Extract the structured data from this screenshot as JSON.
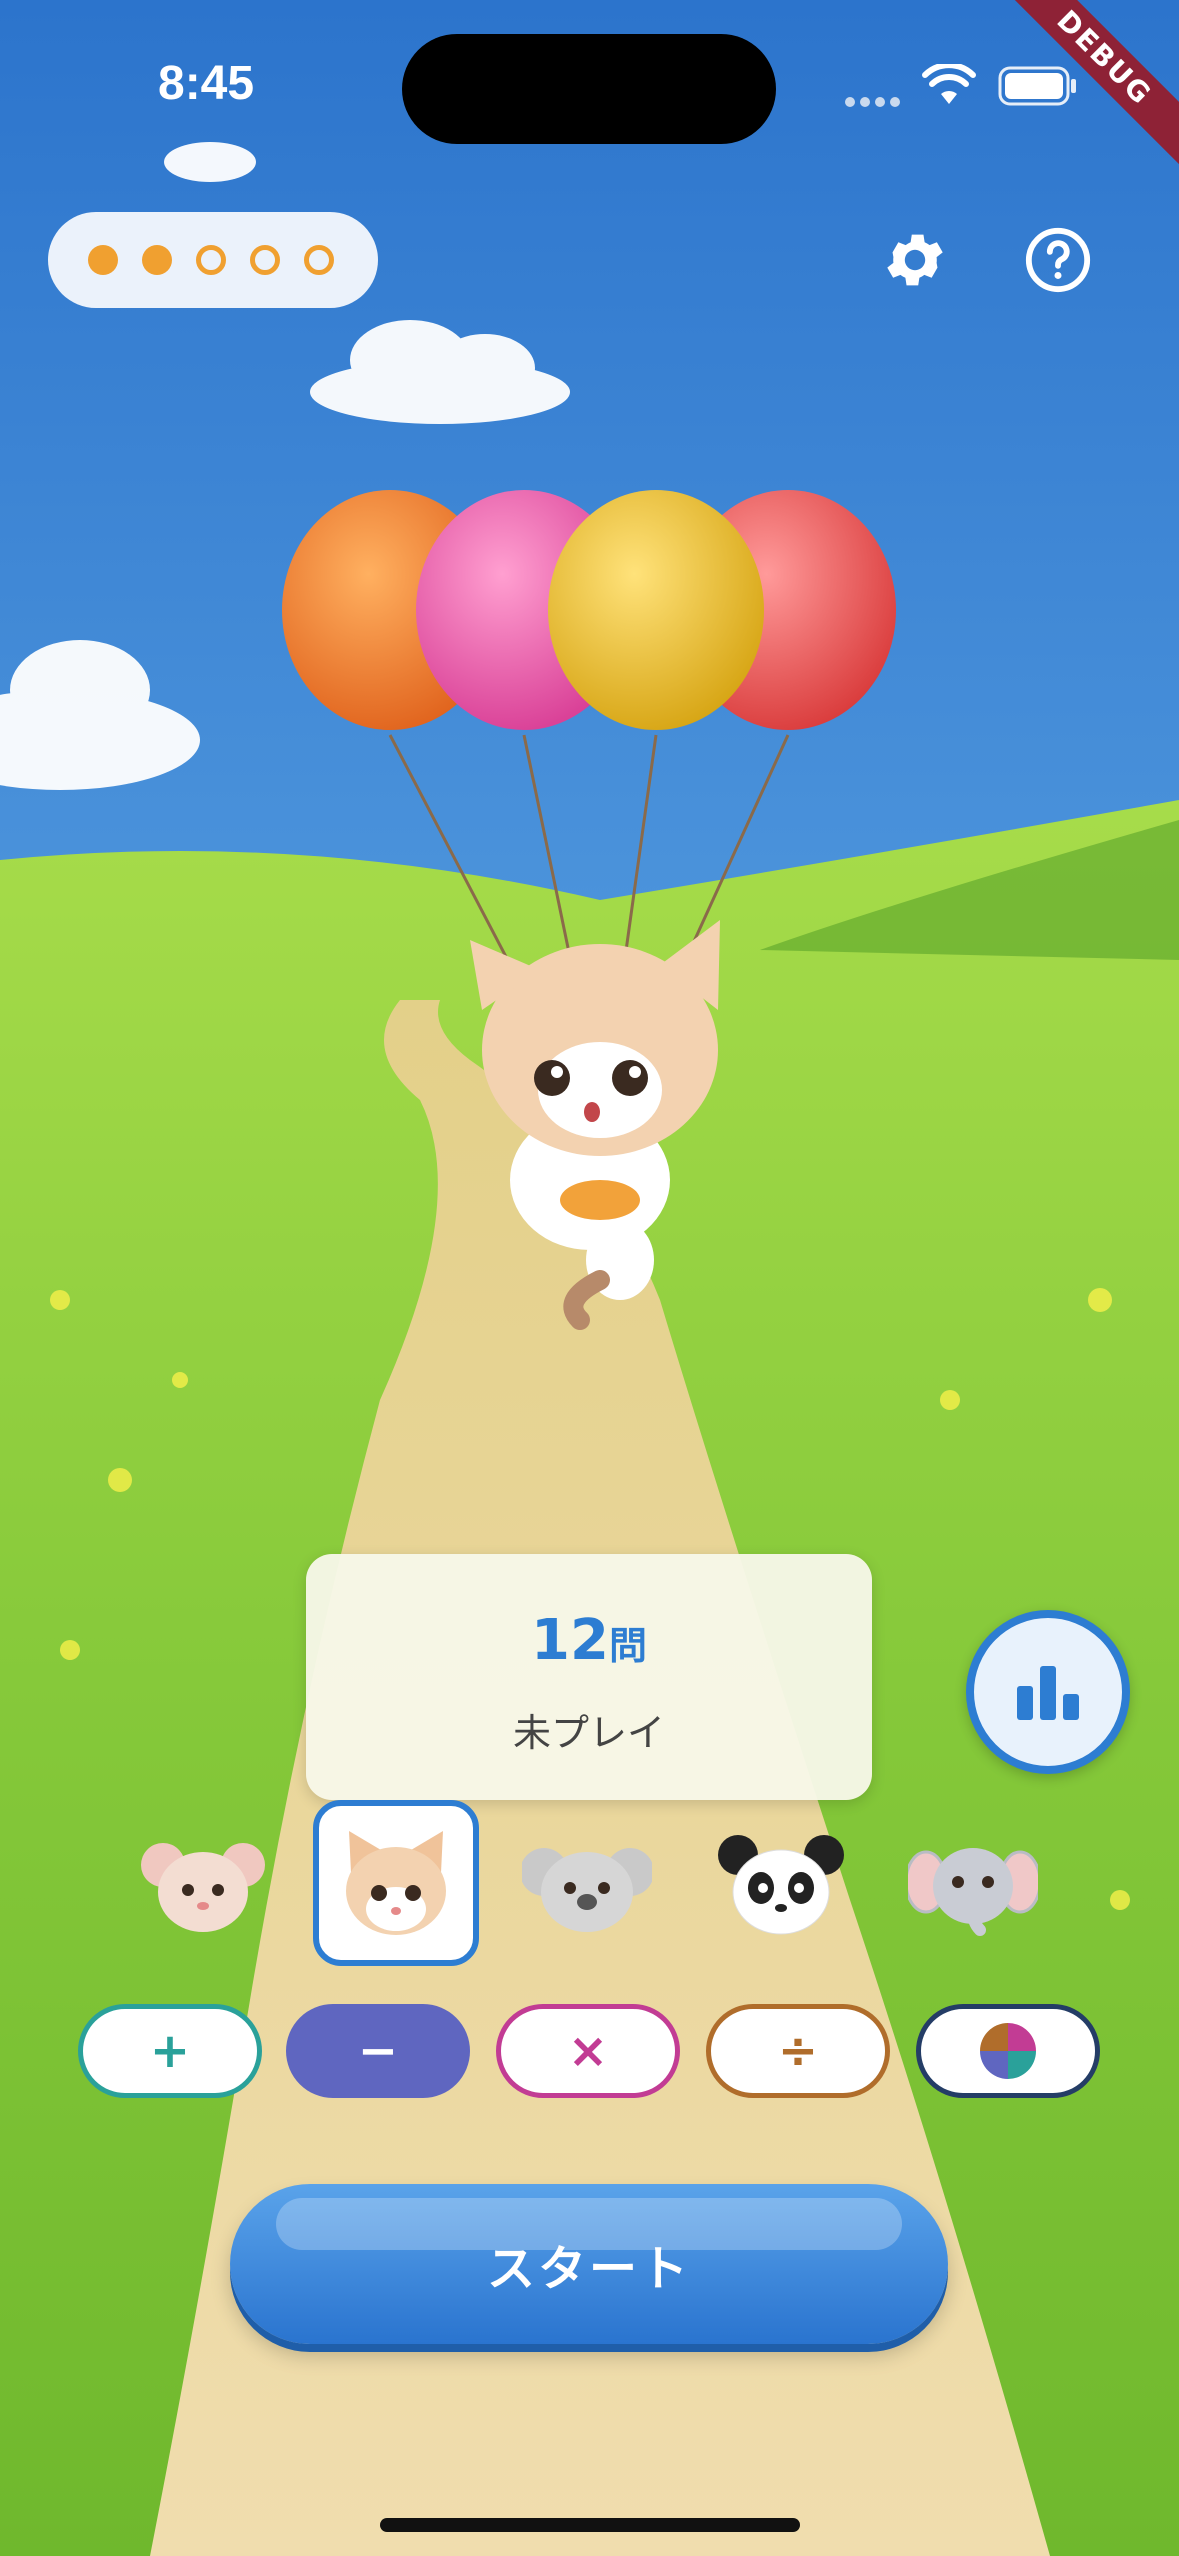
{
  "status_bar": {
    "time": "8:45",
    "debug_banner": "DEBUG",
    "icons": [
      "signal-icon",
      "wifi-icon",
      "battery-icon"
    ]
  },
  "progress": {
    "filled": 2,
    "total": 5,
    "color": "#f0a030"
  },
  "header_buttons": [
    "gear-icon",
    "help-icon"
  ],
  "scene": {
    "balloons": [
      "orange",
      "pink",
      "yellow",
      "red"
    ],
    "character": "cat"
  },
  "info_card": {
    "count": "12",
    "unit": "問",
    "status": "未プレイ"
  },
  "characters": [
    {
      "name": "mouse"
    },
    {
      "name": "cat",
      "selected": true
    },
    {
      "name": "koala"
    },
    {
      "name": "panda"
    },
    {
      "name": "elephant"
    }
  ],
  "operations": [
    {
      "symbol": "+",
      "color": "#2aa19a",
      "selected": false
    },
    {
      "symbol": "−",
      "color": "#5f66c0",
      "selected": true
    },
    {
      "symbol": "×",
      "color": "#c23c94",
      "selected": false
    },
    {
      "symbol": "÷",
      "color": "#b06d2b",
      "selected": false
    },
    {
      "symbol": "",
      "color": "#243d66",
      "selected": false
    }
  ],
  "start_button": {
    "label": "スタート"
  },
  "colors": {
    "accent": "#2d7dd2",
    "sky": "#3c7fd0",
    "grass": "#8fd03a",
    "path": "#ead59a"
  }
}
